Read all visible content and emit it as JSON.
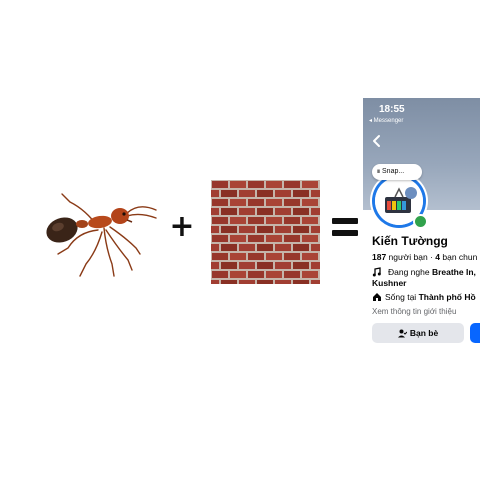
{
  "phone": {
    "status_time": "18:55",
    "back_app": "◂ Messenger",
    "snap_label": "Snap...",
    "profile": {
      "name": "Kiến Tườngg",
      "friends_count": "187",
      "friends_text": " người bạn · ",
      "mutual_count": "4",
      "mutual_text": " bạn chun",
      "music_prefix": "Đang nghe ",
      "music_song": "Breathe In,",
      "music_artist": "Kushner",
      "home_prefix": "Sống tại ",
      "home_city": "Thành phố Hồ",
      "about_link": "Xem thông tin giới thiệu",
      "friends_button": "Bạn bè"
    }
  },
  "colors": {
    "messenger_blue": "#0866ff",
    "online_green": "#31a24c",
    "avatar_ring": "#1e78e8",
    "button_grey": "#e4e6eb"
  }
}
